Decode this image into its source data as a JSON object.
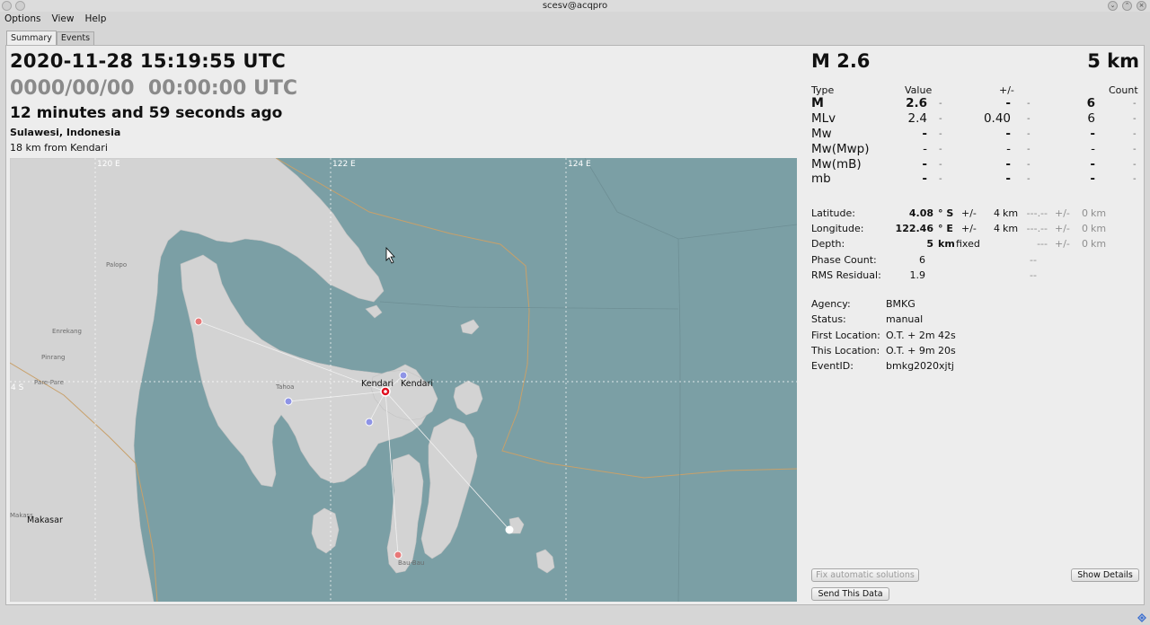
{
  "window": {
    "title": "scesv@acqpro"
  },
  "menu": {
    "options": "Options",
    "view": "View",
    "help": "Help"
  },
  "tabs": {
    "summary": "Summary",
    "events": "Events"
  },
  "event": {
    "origin_time": "2020-11-28 15:19:55 UTC",
    "secondary_time": "0000/00/00  00:00:00 UTC",
    "time_ago": "12 minutes and 59 seconds ago",
    "region": "Sulawesi, Indonesia",
    "nearest_city": "18 km from Kendari",
    "magnitude": "M 2.6",
    "depth": "5 km"
  },
  "magnitudes": {
    "headers": {
      "type": "Type",
      "value": "Value",
      "uncertainty": "+/-",
      "count": "Count"
    },
    "rows": [
      {
        "type": "M",
        "value": "2.6",
        "dash1": "-",
        "unc": "-",
        "dash2": "-",
        "count": "6",
        "dash3": "-"
      },
      {
        "type": "MLv",
        "value": "2.4",
        "dash1": "-",
        "unc": "0.40",
        "dash2": "-",
        "count": "6",
        "dash3": "-"
      },
      {
        "type": "Mw",
        "value": "-",
        "dash1": "-",
        "unc": "-",
        "dash2": "-",
        "count": "-",
        "dash3": "-"
      },
      {
        "type": "Mw(Mwp)",
        "value": "-",
        "dash1": "-",
        "unc": "-",
        "dash2": "-",
        "count": "-",
        "dash3": "-"
      },
      {
        "type": "Mw(mB)",
        "value": "-",
        "dash1": "-",
        "unc": "-",
        "dash2": "-",
        "count": "-",
        "dash3": "-"
      },
      {
        "type": "mb",
        "value": "-",
        "dash1": "-",
        "unc": "-",
        "dash2": "-",
        "count": "-",
        "dash3": "-"
      }
    ]
  },
  "origin": {
    "latitude": {
      "label": "Latitude:",
      "value": "4.08",
      "unit": "° S",
      "pm": "+/-",
      "unc": "4",
      "unc_unit": "km",
      "g1": "---.--",
      "g2": "+/-",
      "g3": "0",
      "g3_unit": "km"
    },
    "longitude": {
      "label": "Longitude:",
      "value": "122.46",
      "unit": "° E",
      "pm": "+/-",
      "unc": "4",
      "unc_unit": "km",
      "g1": "---.--",
      "g2": "+/-",
      "g3": "0",
      "g3_unit": "km"
    },
    "depth": {
      "label": "Depth:",
      "value": "5",
      "unit": "km",
      "fixed": "fixed",
      "g1": "---",
      "g2": "+/-",
      "g3": "0",
      "g3_unit": "km"
    },
    "phase_count": {
      "label": "Phase Count:",
      "value": "6",
      "g": "--"
    },
    "rms": {
      "label": "RMS Residual:",
      "value": "1.9",
      "g": "--"
    }
  },
  "info": {
    "agency": {
      "label": "Agency:",
      "value": "BMKG"
    },
    "status": {
      "label": "Status:",
      "value": "manual"
    },
    "first_location": {
      "label": "First Location:",
      "value": "O.T. + 2m 42s"
    },
    "this_location": {
      "label": "This Location:",
      "value": "O.T. + 9m 20s"
    },
    "event_id": {
      "label": "EventID:",
      "value": "bmkg2020xjtj"
    }
  },
  "buttons": {
    "fix": "Fix automatic solutions",
    "details": "Show Details",
    "send": "Send This Data"
  },
  "map": {
    "colors": {
      "sea": "#7b9fa5",
      "land": "#d3d3d3",
      "border": "#c8a06a",
      "epicenter": "#e01020"
    },
    "grid_labels": {
      "lon120": "120 E",
      "lon122": "122 E",
      "lon124": "124 E",
      "lat4": "4 S"
    },
    "places": {
      "palopo": "Palopo",
      "enrekang": "Enrekang",
      "pinrang": "Pinrang",
      "parepare": "Pare-Pare",
      "tahoa": "Tahoa",
      "kendari1": "Kendari",
      "kendari2": "Kendari",
      "baubau": "Bau-Bau",
      "makassar_small": "Makass",
      "makassar": "Makasar"
    }
  }
}
